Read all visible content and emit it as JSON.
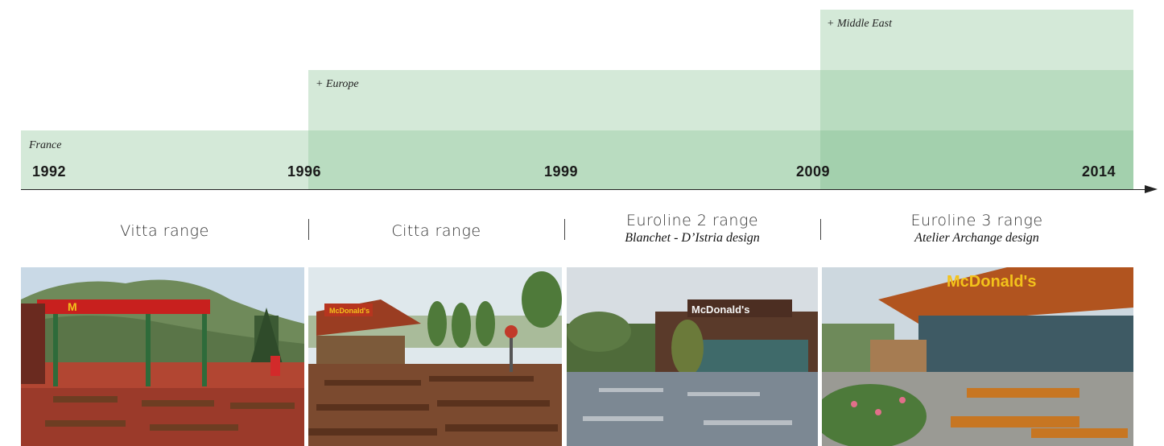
{
  "bands": {
    "france": "France",
    "europe": "+ Europe",
    "middle_east": "+ Middle East"
  },
  "years": [
    "1992",
    "1996",
    "1999",
    "2009",
    "2014"
  ],
  "ranges": [
    {
      "title": "Vitta range",
      "subtitle": ""
    },
    {
      "title": "Citta range",
      "subtitle": ""
    },
    {
      "title": "Euroline 2 range",
      "subtitle": "Blanchet - D’Istria design"
    },
    {
      "title": "Euroline 3 range",
      "subtitle": "Atelier Archange design"
    }
  ],
  "photos": {
    "p1_sign": "M",
    "p2_sign": "McDonald's",
    "p3_sign": "McDonald's",
    "p4_sign": "McDonald's"
  },
  "colors": {
    "band_light": "#d4e9d8",
    "band_mid": "#b9dcc0",
    "band_dark": "#a3d0ad",
    "axis": "#222222"
  }
}
